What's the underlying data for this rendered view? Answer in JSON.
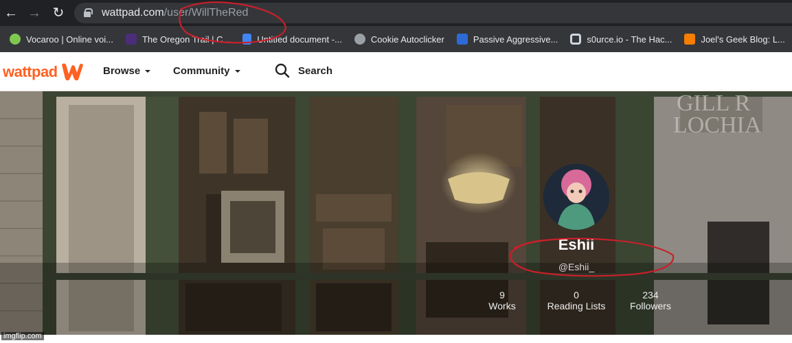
{
  "browser": {
    "url_host": "wattpad.com",
    "url_path": "/user/WillTheRed",
    "bookmarks": [
      {
        "label": "Vocaroo | Online voi...",
        "color": "#7ec850"
      },
      {
        "label": "The Oregon Trail | C...",
        "color": "#4a2e7a"
      },
      {
        "label": "Untitled document -...",
        "color": "#4285f4"
      },
      {
        "label": "Cookie Autoclicker",
        "color": "#9aa0a6"
      },
      {
        "label": "Passive Aggressive...",
        "color": "#2d6ad8"
      },
      {
        "label": "s0urce.io - The Hac...",
        "color": "#cfd6e0"
      },
      {
        "label": "Joel's Geek Blog: L...",
        "color": "#f57d00"
      }
    ]
  },
  "header": {
    "logo": "wattpad",
    "browse": "Browse",
    "community": "Community",
    "search": "Search"
  },
  "profile": {
    "name": "Eshii",
    "handle": "@Eshii_",
    "stats": [
      {
        "value": "9",
        "label": "Works"
      },
      {
        "value": "0",
        "label": "Reading Lists"
      },
      {
        "value": "234",
        "label": "Followers"
      }
    ]
  },
  "watermark": "imgflip.com",
  "colors": {
    "accent": "#ff6122",
    "annotation": "#c8202a"
  }
}
